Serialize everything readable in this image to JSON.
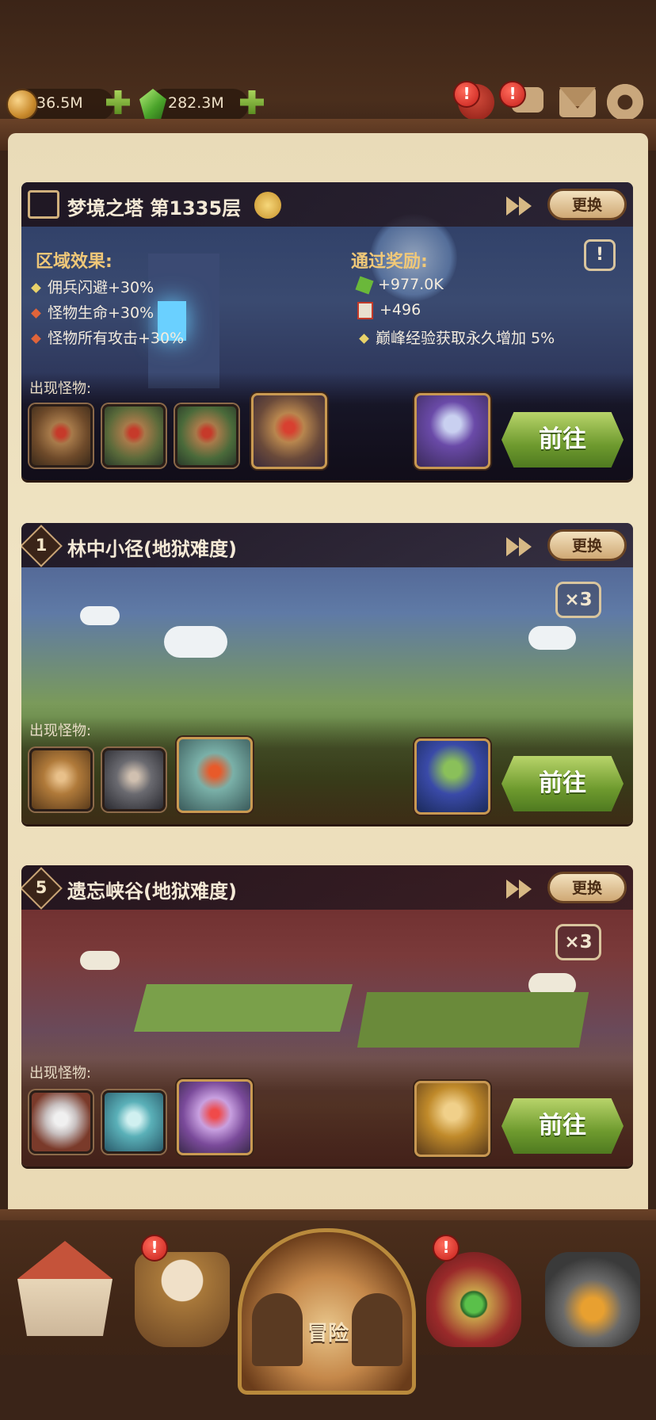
{
  "resources": {
    "gold": "36.5M",
    "gems": "282.3M"
  },
  "top_icons": [
    "pot-icon",
    "chat-icon",
    "mail-icon",
    "gear-icon"
  ],
  "cards": [
    {
      "title": "梦境之塔 第1335层",
      "change_label": "更换",
      "area_effect_title": "区域效果:",
      "effects": [
        "佣兵闪避+30%",
        "怪物生命+30%",
        "怪物所有攻击+30%"
      ],
      "reward_title": "通过奖励:",
      "rewards": [
        "+977.0K",
        "+496",
        "巅峰经验获取永久增加 5%"
      ],
      "monster_label": "出现怪物:",
      "go_label": "前往"
    },
    {
      "level": "1",
      "title": "林中小径(地狱难度)",
      "change_label": "更换",
      "multiplier": "×3",
      "monster_label": "出现怪物:",
      "go_label": "前往"
    },
    {
      "level": "5",
      "title": "遗忘峡谷(地狱难度)",
      "change_label": "更换",
      "multiplier": "×3",
      "monster_label": "出现怪物:",
      "go_label": "前往"
    }
  ],
  "bottom_nav": {
    "adventure_label": "冒险"
  },
  "colors": {
    "accent_green": "#8bb443",
    "alert_red": "#d32a22",
    "parchment": "#efe3c2"
  }
}
